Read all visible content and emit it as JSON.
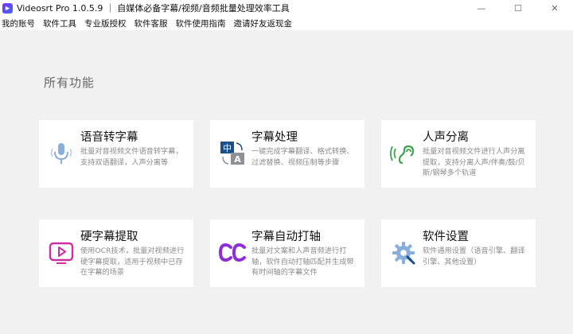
{
  "window": {
    "title": "Videosrt Pro 1.0.5.9 ｜ 自媒体必备字幕/视频/音频批量处理效率工具",
    "controls": {
      "minimize": "—",
      "maximize": "☐",
      "close": "✕"
    }
  },
  "menu": {
    "items": [
      {
        "label": "我的账号"
      },
      {
        "label": "软件工具"
      },
      {
        "label": "专业版授权"
      },
      {
        "label": "软件客服"
      },
      {
        "label": "软件使用指南"
      },
      {
        "label": "邀请好友返现金"
      }
    ]
  },
  "main": {
    "section_title": "所有功能",
    "cards": [
      {
        "title": "语音转字幕",
        "desc": "批量对音视频文件语音转字幕，支持双语翻译，人声分离等",
        "icon": "microphone-icon"
      },
      {
        "title": "字幕处理",
        "desc": "一键完成字幕翻译、格式转换、过滤替换、视频压制等步骤",
        "icon": "translate-icon"
      },
      {
        "title": "人声分离",
        "desc": "批量对音视频文件进行人声分离提取，支持分离人声/伴奏/鼓/贝斯/钢琴多个轨道",
        "icon": "ear-sound-icon"
      },
      {
        "title": "硬字幕提取",
        "desc": "使用OCR技术，批量对视频进行硬字幕提取，适用于视频中已存在字幕的场景",
        "icon": "video-play-icon"
      },
      {
        "title": "字幕自动打轴",
        "desc": "批量对文案和人声音频进行打轴，软件自动打轴匹配并生成带有时间轴的字幕文件",
        "icon": "cc-icon"
      },
      {
        "title": "软件设置",
        "desc": "软件通用设置（语音引擎、翻译引擎、其他设置）",
        "icon": "gear-icon"
      }
    ]
  },
  "colors": {
    "icon_blue": "#8aaedb",
    "icon_green": "#3aa54a",
    "icon_magenta": "#cc2fa0",
    "icon_purple": "#8e2ed6",
    "icon_navy": "#1a4f8a"
  },
  "icon_glyphs": {
    "translate_zh": "中",
    "translate_en": "A"
  }
}
